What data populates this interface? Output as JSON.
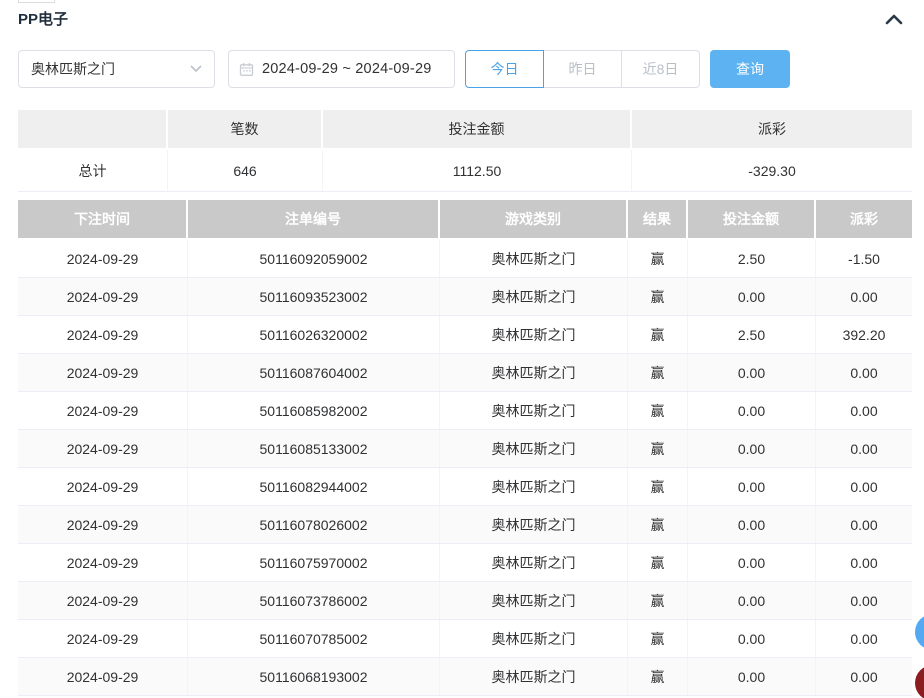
{
  "colors": {
    "accent_blue": "#4aa3e8",
    "query_button_blue": "#5db2f2",
    "negative_red": "#f05e5e",
    "table_header_gray": "#c9c9c9",
    "summary_header_gray": "#efefef"
  },
  "panel": {
    "title": "PP电子"
  },
  "filters": {
    "game_select": {
      "value": "奥林匹斯之门"
    },
    "date_range": {
      "value": "2024-09-29 ~ 2024-09-29"
    },
    "quick_buttons": [
      {
        "label": "今日"
      },
      {
        "label": "昨日"
      },
      {
        "label": "近8日"
      }
    ],
    "query_label": "查询"
  },
  "summary_table": {
    "headers": [
      "",
      "笔数",
      "投注金额",
      "派彩"
    ],
    "total_row": {
      "label": "总计",
      "count": "646",
      "bet_amount": "1112.50",
      "payout": "-329.30"
    }
  },
  "records_table": {
    "headers": [
      "下注时间",
      "注单编号",
      "游戏类别",
      "结果",
      "投注金额",
      "派彩"
    ],
    "rows": [
      {
        "date": "2024-09-29",
        "order_no": "50116092059002",
        "game": "奥林匹斯之门",
        "result": "赢",
        "bet": "2.50",
        "payout": "-1.50"
      },
      {
        "date": "2024-09-29",
        "order_no": "50116093523002",
        "game": "奥林匹斯之门",
        "result": "赢",
        "bet": "0.00",
        "payout": "0.00"
      },
      {
        "date": "2024-09-29",
        "order_no": "50116026320002",
        "game": "奥林匹斯之门",
        "result": "赢",
        "bet": "2.50",
        "payout": "392.20"
      },
      {
        "date": "2024-09-29",
        "order_no": "50116087604002",
        "game": "奥林匹斯之门",
        "result": "赢",
        "bet": "0.00",
        "payout": "0.00"
      },
      {
        "date": "2024-09-29",
        "order_no": "50116085982002",
        "game": "奥林匹斯之门",
        "result": "赢",
        "bet": "0.00",
        "payout": "0.00"
      },
      {
        "date": "2024-09-29",
        "order_no": "50116085133002",
        "game": "奥林匹斯之门",
        "result": "赢",
        "bet": "0.00",
        "payout": "0.00"
      },
      {
        "date": "2024-09-29",
        "order_no": "50116082944002",
        "game": "奥林匹斯之门",
        "result": "赢",
        "bet": "0.00",
        "payout": "0.00"
      },
      {
        "date": "2024-09-29",
        "order_no": "50116078026002",
        "game": "奥林匹斯之门",
        "result": "赢",
        "bet": "0.00",
        "payout": "0.00"
      },
      {
        "date": "2024-09-29",
        "order_no": "50116075970002",
        "game": "奥林匹斯之门",
        "result": "赢",
        "bet": "0.00",
        "payout": "0.00"
      },
      {
        "date": "2024-09-29",
        "order_no": "50116073786002",
        "game": "奥林匹斯之门",
        "result": "赢",
        "bet": "0.00",
        "payout": "0.00"
      },
      {
        "date": "2024-09-29",
        "order_no": "50116070785002",
        "game": "奥林匹斯之门",
        "result": "赢",
        "bet": "0.00",
        "payout": "0.00"
      },
      {
        "date": "2024-09-29",
        "order_no": "50116068193002",
        "game": "奥林匹斯之门",
        "result": "赢",
        "bet": "0.00",
        "payout": "0.00"
      }
    ]
  }
}
